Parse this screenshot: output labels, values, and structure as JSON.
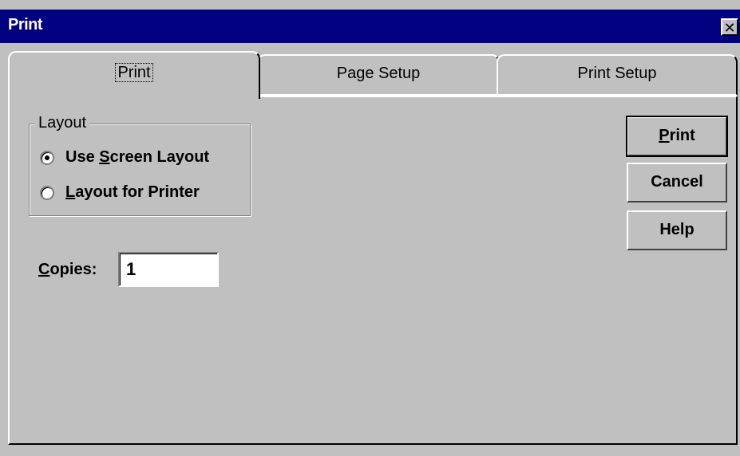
{
  "window": {
    "title": "Print",
    "close_glyph": "✕"
  },
  "tabs": [
    {
      "label": "Print",
      "active": true
    },
    {
      "label": "Page Setup",
      "active": false
    },
    {
      "label": "Print Setup",
      "active": false
    }
  ],
  "layout_group": {
    "legend": "Layout",
    "options": [
      {
        "label_pre": "Use ",
        "mnemonic": "S",
        "label_post": "creen Layout",
        "selected": true
      },
      {
        "label_pre": "",
        "mnemonic": "L",
        "label_post": "ayout for Printer",
        "selected": false
      }
    ]
  },
  "copies": {
    "mnemonic": "C",
    "label_post": "opies:",
    "value": "1"
  },
  "buttons": {
    "print_mnemonic": "P",
    "print_rest": "rint",
    "cancel": "Cancel",
    "help": "Help"
  },
  "colors": {
    "titlebar": "#000080",
    "face": "#c0c0c0"
  }
}
